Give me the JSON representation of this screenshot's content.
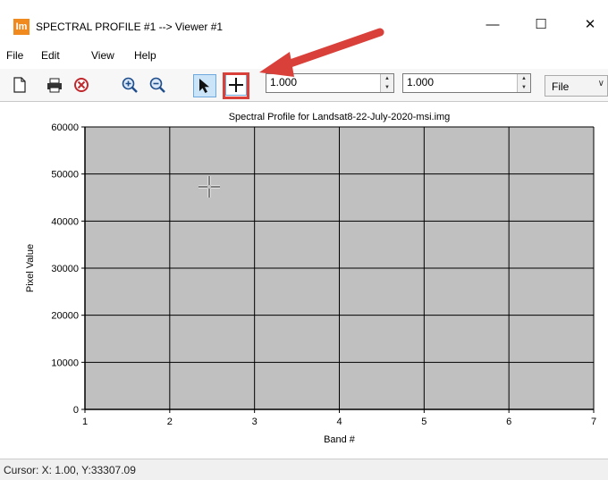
{
  "window": {
    "app_icon_text": "Im",
    "title": "SPECTRAL PROFILE #1 --> Viewer #1",
    "buttons": [
      "minimize",
      "maximize",
      "close"
    ]
  },
  "menu": [
    "File",
    "Edit",
    "View",
    "Help"
  ],
  "toolbar": {
    "icons": [
      "new-document-icon",
      "print-icon",
      "clear-icon",
      "zoom-in-icon",
      "zoom-out-icon",
      "pointer-icon",
      "crosshair-icon"
    ],
    "active_tool": "pointer-icon",
    "highlighted_tool": "crosshair-icon",
    "highlight_color": "#d9403a",
    "field1_value": "1.000",
    "field2_value": "1.000",
    "output_select": "File"
  },
  "annotation": {
    "arrow_color": "#d9403a"
  },
  "chart_data": {
    "type": "line",
    "title": "Spectral Profile for Landsat8-22-July-2020-msi.img",
    "xlabel": "Band #",
    "ylabel": "Pixel Value",
    "x_ticks": [
      1,
      2,
      3,
      4,
      5,
      6,
      7
    ],
    "y_ticks": [
      0,
      10000,
      20000,
      30000,
      40000,
      50000,
      60000
    ],
    "xlim": [
      1,
      7
    ],
    "ylim": [
      0,
      60000
    ],
    "grid": true,
    "plot_background": "#c0c0c0",
    "series": []
  },
  "status": {
    "text": "Cursor: X: 1.00, Y:33307.09"
  }
}
